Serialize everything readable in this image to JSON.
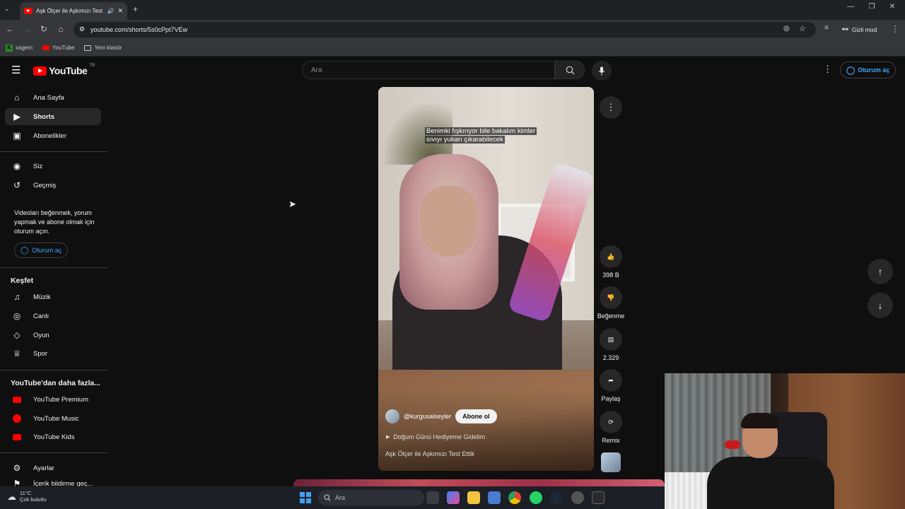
{
  "browser": {
    "tab_title": "Aşk Ölçer ile Aşkımızı Test Ettik",
    "url": "youtube.com/shorts/5s0cPpt7VEw",
    "incognito_label": "Gizli mod",
    "bookmarks": [
      {
        "label": "xagem",
        "icon": "k-logo-icon"
      },
      {
        "label": "YouTube",
        "icon": "youtube-icon"
      },
      {
        "label": "Yeni klasör",
        "icon": "folder-icon"
      }
    ]
  },
  "header": {
    "logo_text": "YouTube",
    "country_code": "TR",
    "search_placeholder": "Ara",
    "signin_label": "Oturum aç"
  },
  "sidebar": {
    "main": [
      {
        "label": "Ana Sayfa",
        "icon": "home-icon"
      },
      {
        "label": "Shorts",
        "icon": "shorts-icon",
        "active": true
      },
      {
        "label": "Abonelikler",
        "icon": "subscriptions-icon"
      }
    ],
    "you": [
      {
        "label": "Siz",
        "icon": "account-icon"
      },
      {
        "label": "Geçmiş",
        "icon": "history-icon"
      }
    ],
    "signin_prompt": "Videoları beğenmek, yorum yapmak ve abone olmak için oturum açın.",
    "signin_label": "Oturum aç",
    "explore_title": "Keşfet",
    "explore": [
      {
        "label": "Müzik",
        "icon": "music-icon"
      },
      {
        "label": "Canlı",
        "icon": "live-icon"
      },
      {
        "label": "Oyun",
        "icon": "gaming-icon"
      },
      {
        "label": "Spor",
        "icon": "trophy-icon"
      }
    ],
    "more_title": "YouTube'dan daha fazla...",
    "more": [
      {
        "label": "YouTube Premium",
        "icon": "youtube-premium-icon"
      },
      {
        "label": "YouTube Music",
        "icon": "youtube-music-icon"
      },
      {
        "label": "YouTube Kids",
        "icon": "youtube-kids-icon"
      }
    ],
    "settings_label": "Ayarlar",
    "cut_off_label": "İçerik bildirme geç..."
  },
  "short": {
    "caption_line1": "Benimki fışkırıyor bile bakalım kimler",
    "caption_line2": "sıvıyı yukarı çıkarabilecek",
    "channel": "@kurgusalseyler",
    "subscribe_label": "Abone ol",
    "music": "Doğum Günü Hediyeme Gidelim",
    "title": "Aşk Ölçer ile Aşkımızı Test Ettik"
  },
  "actions": {
    "like_count": "398 B",
    "dislike_label": "Beğenme",
    "comment_count": "2.329",
    "share_label": "Paylaş",
    "remix_label": "Remix"
  },
  "taskbar": {
    "temperature": "11°C",
    "weather": "Çok bulutlu",
    "search_label": "Ara"
  }
}
